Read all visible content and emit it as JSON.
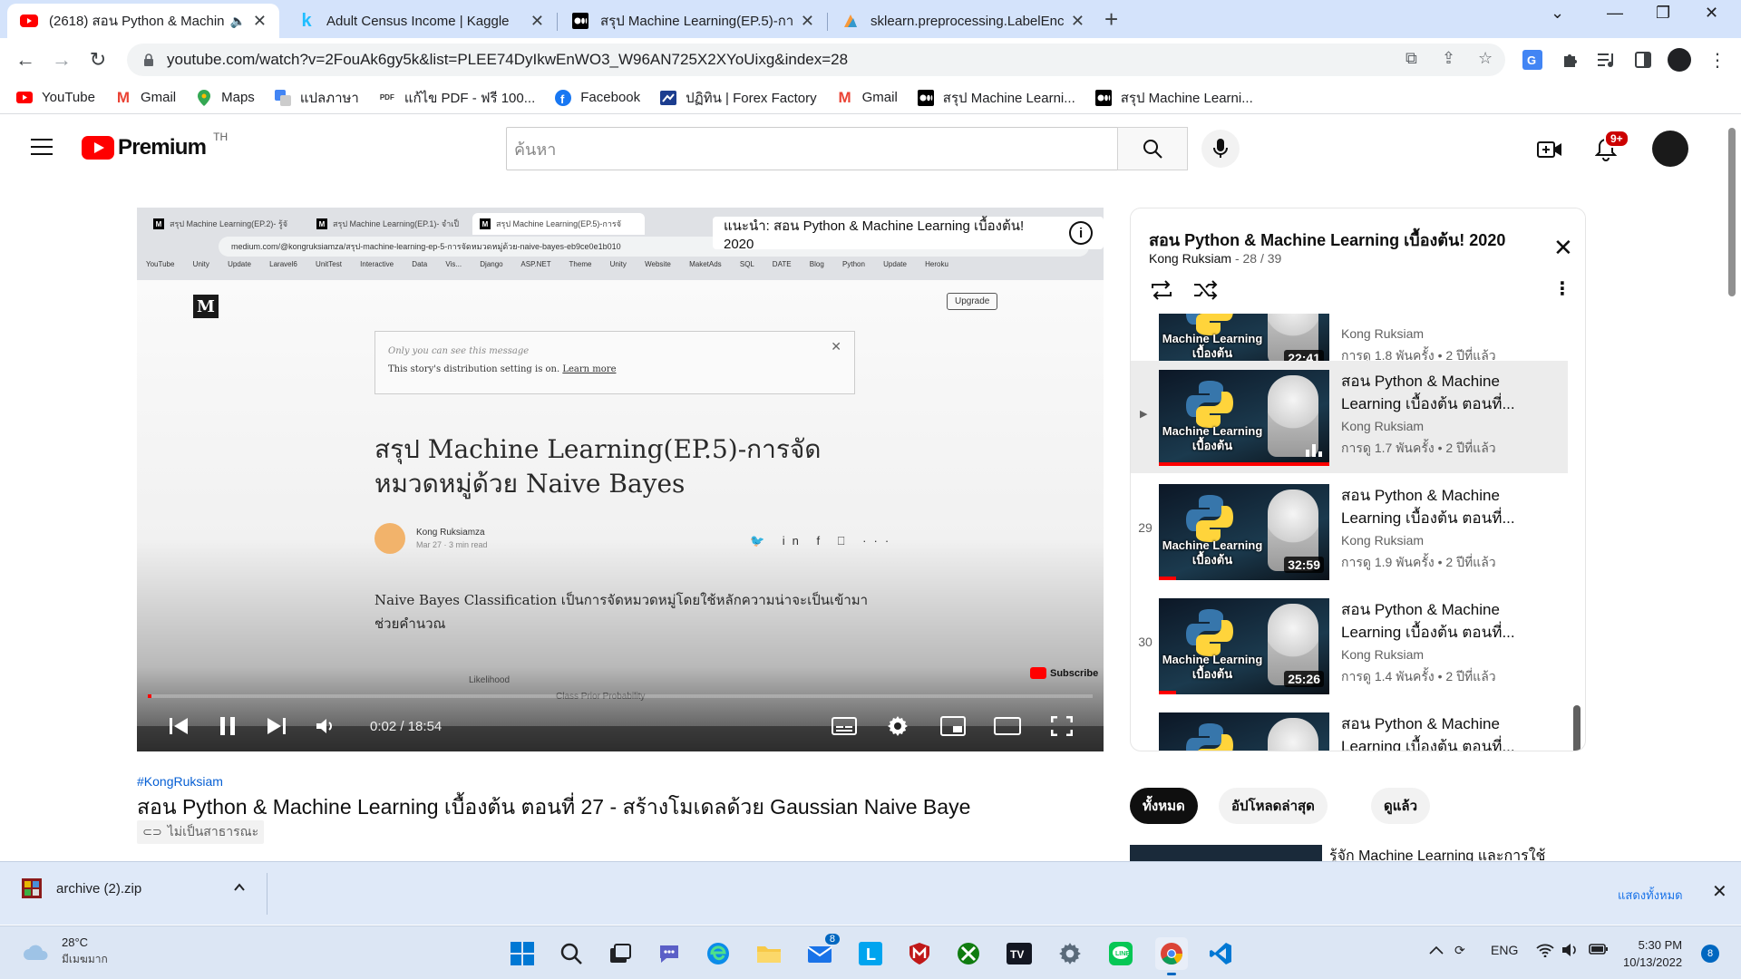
{
  "browser": {
    "tabs": [
      {
        "title": "(2618) สอน Python & Machin",
        "icon": "youtube-icon",
        "active": true,
        "audio": true
      },
      {
        "title": "Adult Census Income | Kaggle",
        "icon": "kaggle-icon",
        "active": false
      },
      {
        "title": "สรุป Machine Learning(EP.5)-การจั",
        "icon": "medium-icon",
        "active": false
      },
      {
        "title": "sklearn.preprocessing.LabelEnco",
        "icon": "sklearn-icon",
        "active": false
      }
    ],
    "url": "youtube.com/watch?v=2FouAk6gy5k&list=PLEE74DyIkwEnWO3_W96AN725X2XYoUixg&index=28",
    "bookmarks": [
      {
        "label": "YouTube",
        "icon": "youtube-icon"
      },
      {
        "label": "Gmail",
        "icon": "gmail-icon"
      },
      {
        "label": "Maps",
        "icon": "maps-icon"
      },
      {
        "label": "แปลภาษา",
        "icon": "translate-icon"
      },
      {
        "label": "แก้ไข PDF - ฟรี 100...",
        "icon": "pdf-icon"
      },
      {
        "label": "Facebook",
        "icon": "facebook-icon"
      },
      {
        "label": "ปฏิทิน | Forex Factory",
        "icon": "forex-icon"
      },
      {
        "label": "Gmail",
        "icon": "gmail-icon"
      },
      {
        "label": "สรุป Machine Learni...",
        "icon": "medium-icon"
      },
      {
        "label": "สรุป Machine Learni...",
        "icon": "medium-icon"
      }
    ]
  },
  "youtube": {
    "logo_word": "Premium",
    "country": "TH",
    "search_placeholder": "ค้นหา",
    "notifications_badge": "9+",
    "accent": "#ff0000"
  },
  "player": {
    "suggestion": "แนะนำ: สอน Python & Machine Learning เบื้องต้น! 2020",
    "time_current": "0:02",
    "time_total": "18:54",
    "progress_fraction": 0.002,
    "embedded": {
      "tabs": [
        "สรุป Machine Learning(EP.2)- รู้จั",
        "สรุป Machine Learning(EP.1)- จำเป็",
        "สรุป Machine Learning(EP.5)-การจั"
      ],
      "url": "medium.com/@kongruksiamza/สรุป-machine-learning-ep-5-การจัดหมวดหมู่ด้วย-naive-bayes-eb9ce0e1b010",
      "bookmarks": "YouTube Unity Update Laravel6 UnitTest Interactive Data Vis... Django ASP.NET Theme Unity Website MaketAds SQL DATE Blog Python Update Heroku",
      "upgrade": "Upgrade",
      "note_line1": "Only you can see this message",
      "note_line2": "This story's distribution setting is on.",
      "note_link": "Learn more",
      "headline": "สรุป Machine Learning(EP.5)-การจัดหมวดหมู่ด้วย Naive Bayes",
      "author": "Kong Ruksiamza",
      "meta": "Mar 27 · 3 min read",
      "body": "Naive Bayes Classification เป็นการจัดหมวดหมู่โดยใช้หลักความน่าจะเป็นเข้ามาช่วยคำนวณ",
      "diag_left": "Likelihood",
      "diag_right": "Class Prior Probability",
      "subscribe": "Subscribe"
    }
  },
  "video": {
    "hashtag": "#KongRuksiam",
    "title": "สอน Python & Machine Learning เบื้องต้น ตอนที่ 27 - สร้างโมเดลด้วย Gaussian Naive Baye",
    "visibility": "ไม่เป็นสาธารณะ"
  },
  "playlist": {
    "title": "สอน Python & Machine Learning เบื้องต้น! 2020",
    "channel": "Kong Ruksiam",
    "position": "28 / 39",
    "items": [
      {
        "index": "",
        "title": "",
        "channel": "Kong Ruksiam",
        "views": "การดู 1.8 พันครั้ง • 2 ปีที่แล้ว",
        "duration": "22:41",
        "caption": "Machine Learning เบื้องต้น",
        "watched": 0.12,
        "current": false
      },
      {
        "index": "▶",
        "title": "สอน Python & Machine Learning เบื้องต้น ตอนที่...",
        "channel": "Kong Ruksiam",
        "views": "การดู 1.7 พันครั้ง • 2 ปีที่แล้ว",
        "duration": "",
        "caption": "Machine Learning เบื้องต้น",
        "watched": 1.0,
        "current": true
      },
      {
        "index": "29",
        "title": "สอน Python & Machine Learning เบื้องต้น ตอนที่...",
        "channel": "Kong Ruksiam",
        "views": "การดู 1.9 พันครั้ง • 2 ปีที่แล้ว",
        "duration": "32:59",
        "caption": "Machine Learning เบื้องต้น",
        "watched": 0.1,
        "current": false
      },
      {
        "index": "30",
        "title": "สอน Python & Machine Learning เบื้องต้น ตอนที่...",
        "channel": "Kong Ruksiam",
        "views": "การดู 1.4 พันครั้ง • 2 ปีที่แล้ว",
        "duration": "25:26",
        "caption": "Machine Learning เบื้องต้น",
        "watched": 0.1,
        "current": false
      },
      {
        "index": "",
        "title": "สอน Python & Machine Learning เบื้องต้น ตอนที่...",
        "channel": "",
        "views": "",
        "duration": "",
        "caption": "",
        "watched": 0,
        "current": false
      }
    ]
  },
  "chips": [
    "ทั้งหมด",
    "อัปโหลดล่าสุด",
    "ดูแล้ว"
  ],
  "recommendation_title": "รู้จัก Machine Learning และการใช้",
  "download": {
    "filename": "archive (2).zip",
    "show_all": "แสดงทั้งหมด"
  },
  "taskbar": {
    "temperature": "28°C",
    "weather": "มีเมฆมาก",
    "mail_badge": "8",
    "language": "ENG",
    "time": "5:30 PM",
    "date": "10/13/2022",
    "notifications": "8"
  }
}
